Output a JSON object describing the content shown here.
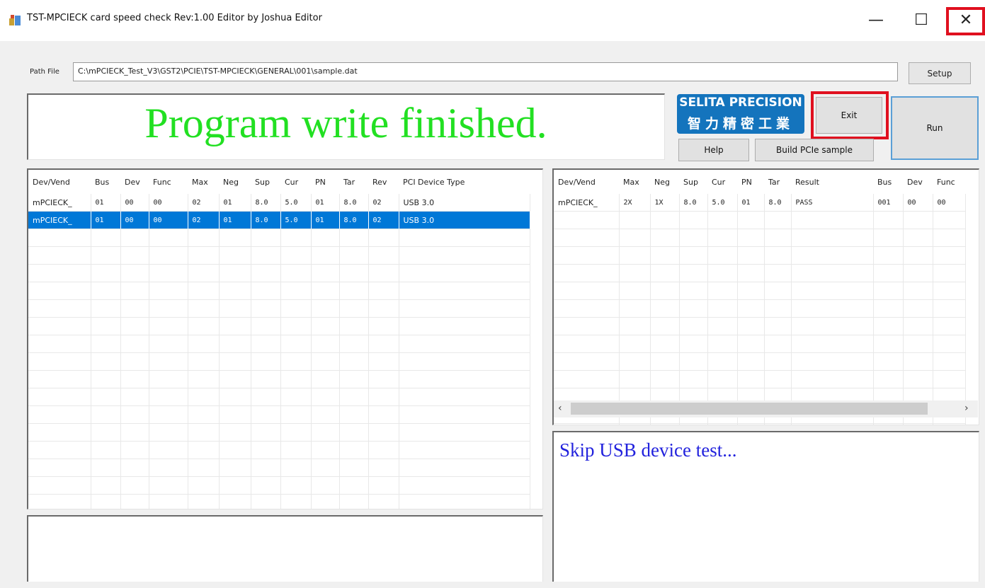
{
  "window": {
    "title": "TST-MPCIECK card speed check Rev:1.00 Editor by Joshua Editor",
    "min_glyph": "—",
    "max_glyph": "☐",
    "close_glyph": "✕"
  },
  "path": {
    "label": "Path File",
    "value": "C:\\mPCIECK_Test_V3\\GST2\\PCIE\\TST-MPCIECK\\GENERAL\\001\\sample.dat"
  },
  "buttons": {
    "setup": "Setup",
    "exit": "Exit",
    "run": "Run",
    "help": "Help",
    "build": "Build PCIe sample"
  },
  "logo": {
    "en": "SELITA PRECISION",
    "zh": "智力精密工業"
  },
  "status_message": "Program write finished.",
  "left_table": {
    "columns": [
      "Dev/Vend",
      "Bus",
      "Dev",
      "Func",
      "Max",
      "Neg",
      "Sup",
      "Cur",
      "PN",
      "Tar",
      "Rev",
      "PCI Device Type"
    ],
    "rows": [
      [
        "mPCIECK_",
        "01",
        "00",
        "00",
        "02",
        "01",
        "8.0",
        "5.0",
        "01",
        "8.0",
        "02",
        "USB 3.0"
      ],
      [
        "mPCIECK_",
        "01",
        "00",
        "00",
        "02",
        "01",
        "8.0",
        "5.0",
        "01",
        "8.0",
        "02",
        "USB 3.0"
      ]
    ],
    "selected_row": 1
  },
  "right_table": {
    "columns": [
      "Dev/Vend",
      "Max",
      "Neg",
      "Sup",
      "Cur",
      "PN",
      "Tar",
      "Result",
      "Bus",
      "Dev",
      "Func"
    ],
    "rows": [
      [
        "mPCIECK_",
        "2X",
        "1X",
        "8.0",
        "5.0",
        "01",
        "8.0",
        "PASS",
        "001",
        "00",
        "00"
      ]
    ]
  },
  "scrollbar": {
    "left": "‹",
    "right": "›"
  },
  "log_right": "Skip USB device test...",
  "colors": {
    "status_text": "#22e022",
    "log_text": "#2222dd",
    "selection": "#0078d7",
    "highlight": "#e0101f",
    "logo_bg": "#1474bd"
  }
}
